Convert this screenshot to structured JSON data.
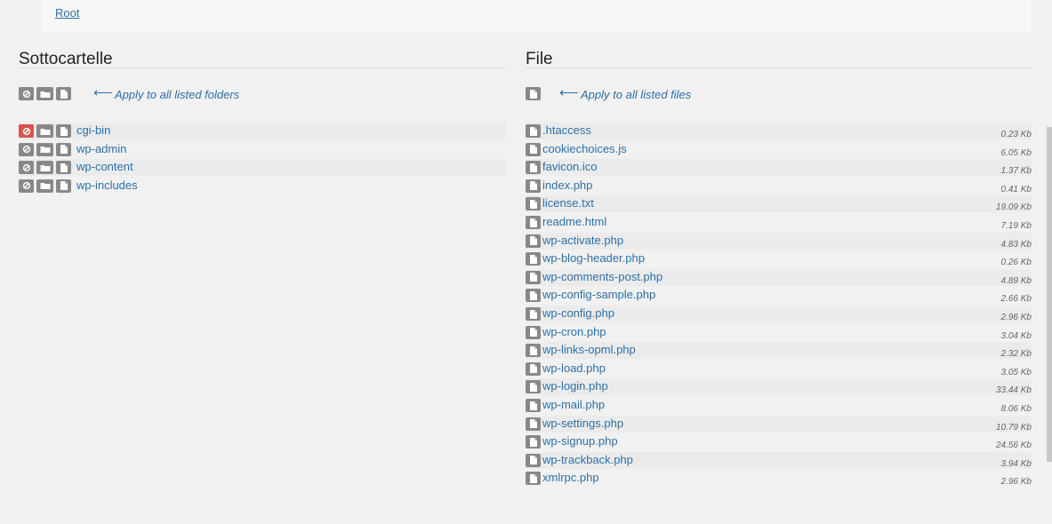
{
  "breadcrumb": {
    "root_label": "Root"
  },
  "folders_panel": {
    "title": "Sottocartelle",
    "apply_label": "Apply to all listed folders",
    "items": [
      {
        "name": "cgi-bin",
        "blocked": true
      },
      {
        "name": "wp-admin",
        "blocked": false
      },
      {
        "name": "wp-content",
        "blocked": false
      },
      {
        "name": "wp-includes",
        "blocked": false
      }
    ]
  },
  "files_panel": {
    "title": "File",
    "apply_label": "Apply to all listed files",
    "items": [
      {
        "name": ".htaccess",
        "size": "0.23 Kb"
      },
      {
        "name": "cookiechoices.js",
        "size": "6.05 Kb"
      },
      {
        "name": "favicon.ico",
        "size": "1.37 Kb"
      },
      {
        "name": "index.php",
        "size": "0.41 Kb"
      },
      {
        "name": "license.txt",
        "size": "19.09 Kb"
      },
      {
        "name": "readme.html",
        "size": "7.19 Kb"
      },
      {
        "name": "wp-activate.php",
        "size": "4.83 Kb"
      },
      {
        "name": "wp-blog-header.php",
        "size": "0.26 Kb"
      },
      {
        "name": "wp-comments-post.php",
        "size": "4.89 Kb"
      },
      {
        "name": "wp-config-sample.php",
        "size": "2.66 Kb"
      },
      {
        "name": "wp-config.php",
        "size": "2.96 Kb"
      },
      {
        "name": "wp-cron.php",
        "size": "3.04 Kb"
      },
      {
        "name": "wp-links-opml.php",
        "size": "2.32 Kb"
      },
      {
        "name": "wp-load.php",
        "size": "3.05 Kb"
      },
      {
        "name": "wp-login.php",
        "size": "33.44 Kb"
      },
      {
        "name": "wp-mail.php",
        "size": "8.06 Kb"
      },
      {
        "name": "wp-settings.php",
        "size": "10.79 Kb"
      },
      {
        "name": "wp-signup.php",
        "size": "24.56 Kb"
      },
      {
        "name": "wp-trackback.php",
        "size": "3.94 Kb"
      },
      {
        "name": "xmlrpc.php",
        "size": "2.96 Kb"
      }
    ]
  },
  "colors": {
    "link": "#2e6fa7",
    "button_gray": "#888888",
    "button_blocked": "#d9534f"
  },
  "icons": {
    "block": "ban-icon",
    "folder": "folder-icon",
    "file": "file-icon",
    "arrow": "arrow-left-icon"
  }
}
